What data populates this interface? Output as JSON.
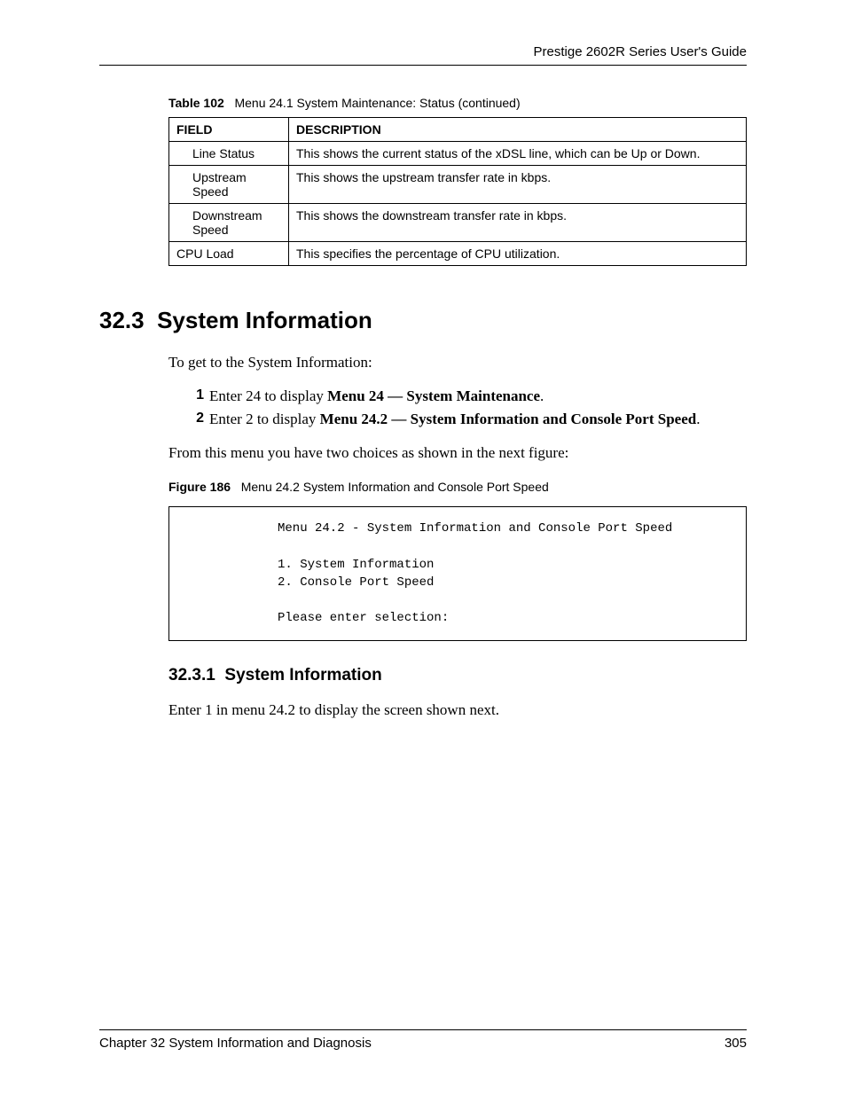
{
  "header": {
    "guide_title": "Prestige 2602R Series User's Guide"
  },
  "table_caption": {
    "label": "Table 102",
    "title": "Menu 24.1 System Maintenance: Status (continued)"
  },
  "table": {
    "headers": {
      "field": "FIELD",
      "description": "DESCRIPTION"
    },
    "rows": [
      {
        "field": "Line Status",
        "indent": true,
        "description": "This shows the current status of the xDSL line, which can be Up or Down."
      },
      {
        "field": "Upstream Speed",
        "indent": true,
        "description": "This shows the upstream transfer rate in kbps."
      },
      {
        "field": "Downstream Speed",
        "indent": true,
        "description": "This shows the downstream transfer rate in kbps."
      },
      {
        "field": "CPU Load",
        "indent": false,
        "description": "This specifies the percentage of CPU utilization."
      }
    ]
  },
  "section": {
    "number": "32.3",
    "title": "System Information",
    "intro": "To get to the System Information:",
    "steps": [
      {
        "num": "1",
        "pre": "Enter 24 to display ",
        "bold": "Menu 24 — System Maintenance",
        "post": "."
      },
      {
        "num": "2",
        "pre": "Enter 2 to display ",
        "bold": "Menu 24.2 — System Information and Console Port Speed",
        "post": "."
      }
    ],
    "after_steps": "From this menu you have two choices as shown in the next figure:"
  },
  "figure": {
    "label": "Figure 186",
    "title": "Menu 24.2 System Information and Console Port Speed",
    "console": "Menu 24.2 - System Information and Console Port Speed\n\n1. System Information\n2. Console Port Speed\n\nPlease enter selection:"
  },
  "subsection": {
    "number": "32.3.1",
    "title": "System Information",
    "body": "Enter 1 in menu 24.2 to display the screen shown next."
  },
  "footer": {
    "chapter": "Chapter 32 System Information and Diagnosis",
    "page": "305"
  }
}
